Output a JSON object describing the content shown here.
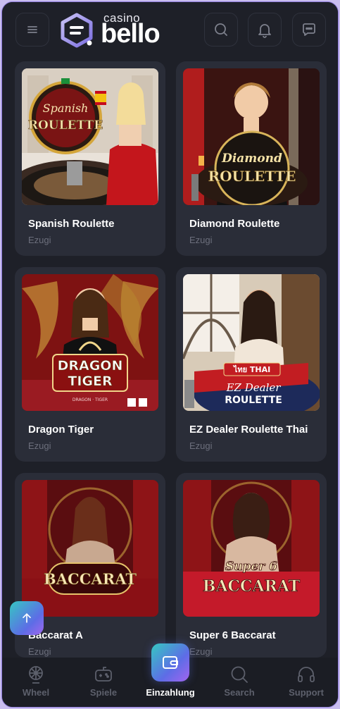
{
  "brand": {
    "small": "casino",
    "name": "bello"
  },
  "header": {
    "menu_icon": "hamburger-icon",
    "search_icon": "search-icon",
    "notifications_icon": "bell-icon",
    "chat_icon": "chat-icon"
  },
  "games": [
    {
      "title": "Spanish Roulette",
      "provider": "Ezugi",
      "art": "SPANISH ROULETTE"
    },
    {
      "title": "Diamond Roulette",
      "provider": "Ezugi",
      "art": "DIAMOND ROULETTE"
    },
    {
      "title": "Dragon Tiger",
      "provider": "Ezugi",
      "art": "DRAGON TIGER"
    },
    {
      "title": "EZ Dealer Roulette Thai",
      "provider": "Ezugi",
      "art": "EZ DEALER ROULETTE ไทย THAI"
    },
    {
      "title": "Baccarat A",
      "provider": "Ezugi",
      "art": "BACCARAT"
    },
    {
      "title": "Super 6 Baccarat",
      "provider": "Ezugi",
      "art": "SUPER 6 BACCARAT"
    }
  ],
  "art_text": {
    "spanish_1": "Spanish",
    "spanish_2": "ROULETTE",
    "diamond_1": "Diamond",
    "diamond_2": "ROULETTE",
    "dragon_1": "DRAGON",
    "dragon_2": "TIGER",
    "ez_thai": "ไทย THAI",
    "ez_1": "EZ Dealer",
    "ez_2": "ROULETTE",
    "baccarat": "BACCARAT",
    "super6": "Super 6",
    "super6_b": "BACCARAT"
  },
  "bottom_nav": [
    {
      "label": "Wheel",
      "icon": "wheel-icon"
    },
    {
      "label": "Spiele",
      "icon": "gamepad-icon"
    },
    {
      "label": "Einzahlung",
      "icon": "wallet-icon"
    },
    {
      "label": "Search",
      "icon": "search-icon"
    },
    {
      "label": "Support",
      "icon": "headset-icon"
    }
  ],
  "colors": {
    "background": "#1e2028",
    "card": "#2a2d38",
    "accent_gradient_start": "#35c7c2",
    "accent_gradient_end": "#a264f0",
    "muted_text": "#6c6f7c"
  }
}
